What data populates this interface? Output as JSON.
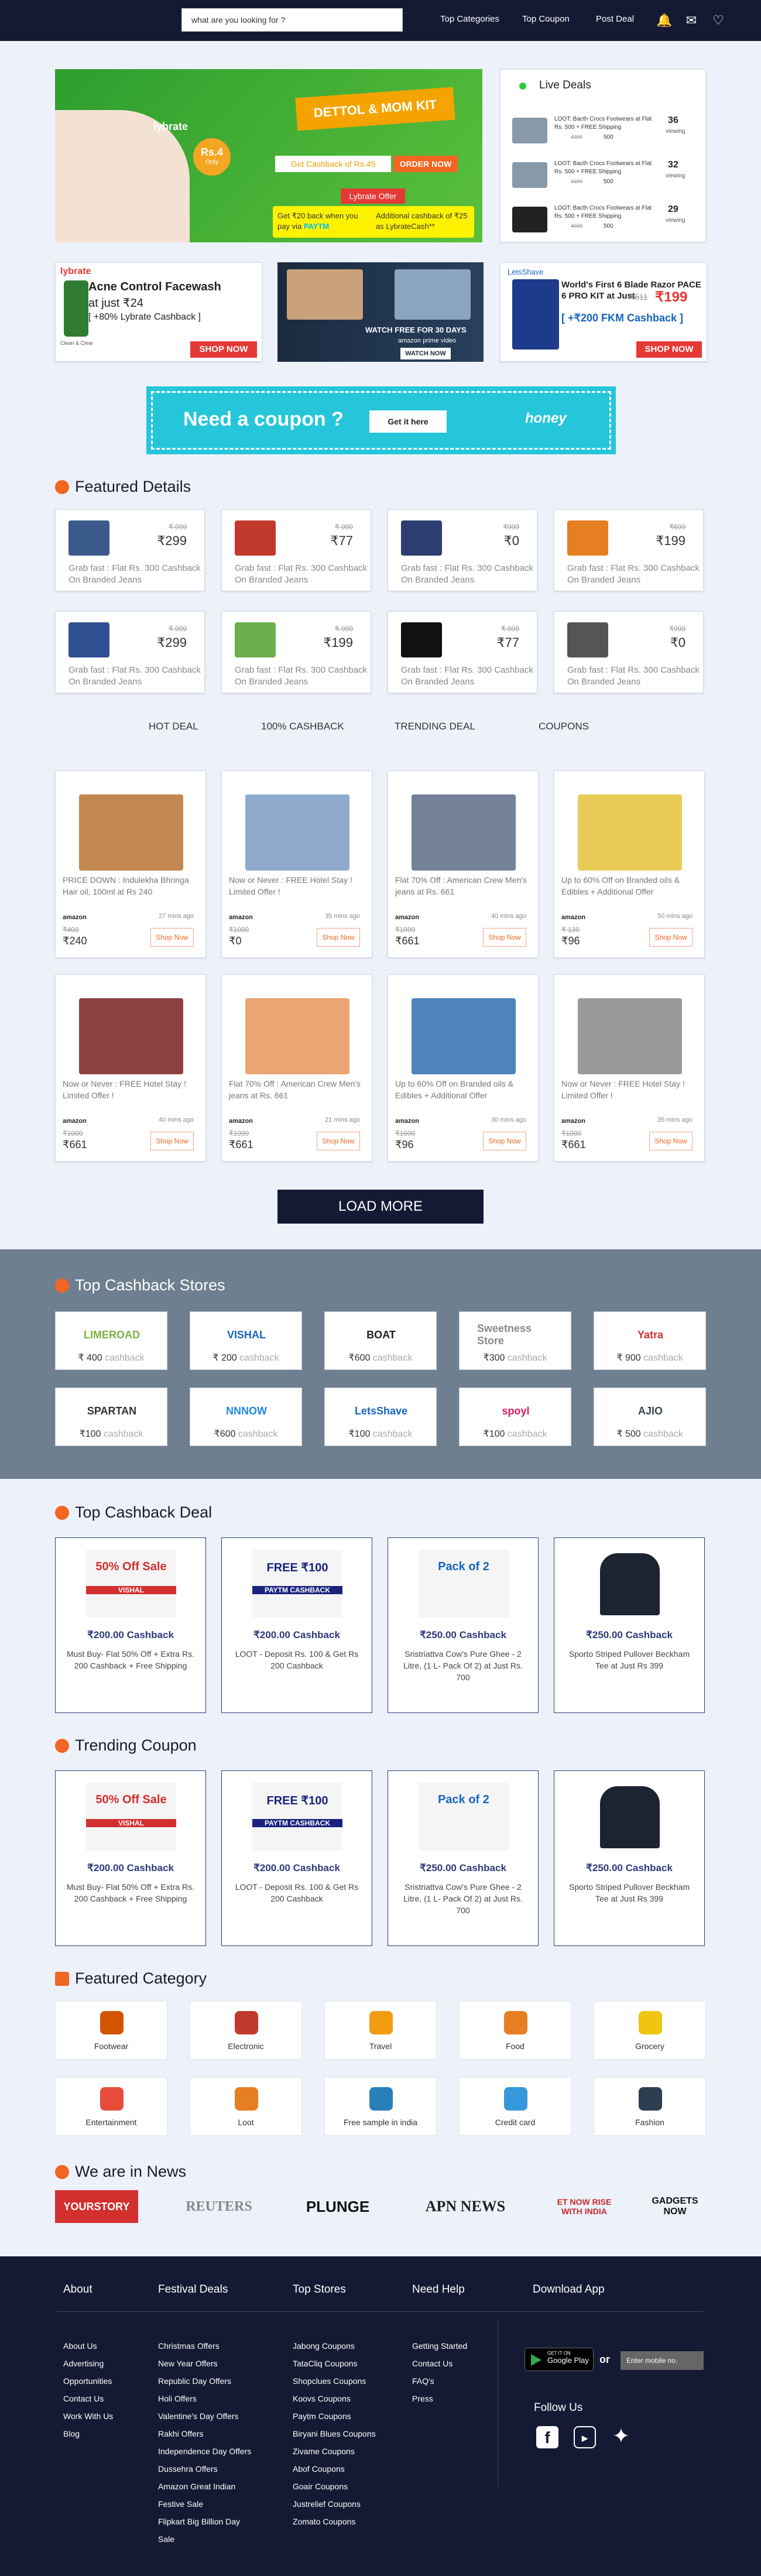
{
  "header": {
    "search_placeholder": "what are you looking for ?",
    "nav": [
      "Top Categories",
      "Top Coupon",
      "Post Deal"
    ]
  },
  "hero": {
    "brand": "lybrate",
    "kit_title": "DETTOL & MOM KIT",
    "price": "Rs.4",
    "price_sub": "Only",
    "cashback": "Get Cashback of Rs.45",
    "order_btn": "ORDER NOW",
    "offer_tag": "Lybrate Offer",
    "offer_left": "Get ₹20 back when you pay via",
    "offer_left_brand": "PAYTM",
    "offer_right": "Additional cashback of ₹25 as LybrateCash**"
  },
  "live_deals": {
    "title": "Live Deals",
    "items": [
      {
        "title": "LOOT: Bacth Crocs Footwears at Flat Rs. 500 + FREE Shipping",
        "old": "4999",
        "new": "500",
        "count": "36",
        "count_label": "viewing"
      },
      {
        "title": "LOOT: Bacth Crocs Footwears at Flat Rs. 500 + FREE Shipping",
        "old": "4999",
        "new": "500",
        "count": "32",
        "count_label": "viewing"
      },
      {
        "title": "LOOT: Bacth Crocs Footwears at Flat Rs. 500 + FREE Shipping",
        "old": "4999",
        "new": "500",
        "count": "29",
        "count_label": "viewing"
      }
    ]
  },
  "promo1": {
    "brand": "lybrate",
    "title": "Acne Control Facewash",
    "subtitle": "at just ₹24",
    "note": "[ +80% Lybrate Cashback ]",
    "btn": "SHOP NOW",
    "product": "Clean & Clear"
  },
  "promo2": {
    "title": "WATCH FREE FOR 30 DAYS",
    "brand": "amazon prime video",
    "btn": "WATCH NOW"
  },
  "promo3": {
    "brand": "LetsShave",
    "title": "World's First 6 Blade Razor PACE 6 PRO KIT at Just",
    "old": "₹611",
    "new": "₹199",
    "note": "[ +₹200 FKM Cashback ]",
    "btn": "SHOP NOW"
  },
  "coupon_banner": {
    "title": "Need a coupon ?",
    "btn": "Get it here",
    "brand": "honey"
  },
  "featured": {
    "title": "Featured Details",
    "items": [
      {
        "old": "₹ 999",
        "new": "₹299",
        "desc": "Grab fast : Flat Rs. 300 Cashback On Branded Jeans",
        "color": "#3a5a8c"
      },
      {
        "old": "₹ 999",
        "new": "₹77",
        "desc": "Grab fast : Flat Rs. 300 Cashback On Branded Jeans",
        "color": "#c0392b"
      },
      {
        "old": "₹999",
        "new": "₹0",
        "desc": "Grab fast : Flat Rs. 300 Cashback On Branded Jeans",
        "color": "#2c3e70"
      },
      {
        "old": "₹699",
        "new": "₹199",
        "desc": "Grab fast : Flat Rs. 300 Cashback On Branded Jeans",
        "color": "#e67e22"
      },
      {
        "old": "₹ 999",
        "new": "₹299",
        "desc": "Grab fast : Flat Rs. 300 Cashback On Branded Jeans",
        "color": "#2e5090"
      },
      {
        "old": "₹ 999",
        "new": "₹199",
        "desc": "Grab fast : Flat Rs. 300 Cashback On Branded Jeans",
        "color": "#6ab04c"
      },
      {
        "old": "₹ 999",
        "new": "₹77",
        "desc": "Grab fast : Flat Rs. 300 Cashback On Branded Jeans",
        "color": "#111111"
      },
      {
        "old": "₹999",
        "new": "₹0",
        "desc": "Grab fast : Flat Rs. 300 Cashback On Branded Jeans",
        "color": "#555555"
      }
    ]
  },
  "tabs": [
    "HOT DEAL",
    "100% CASHBACK",
    "TRENDING DEAL",
    "COUPONS"
  ],
  "deals": [
    {
      "title": "PRICE DOWN : Indulekha Bhringa Hair oil, 100ml at Rs 240",
      "brand": "amazon",
      "time": "27 mins ago",
      "old": "₹400",
      "new": "₹240",
      "btn": "Shop Now",
      "color": "#b87333"
    },
    {
      "title": "Now or Never : FREE Hotel Stay ! Limited Offer !",
      "brand": "amazon",
      "time": "35 mins ago",
      "old": "₹1000",
      "new": "₹0",
      "btn": "Shop Now",
      "color": "#7a9cc6"
    },
    {
      "title": "Flat 70% Off : American Crew Men's jeans at Rs. 661",
      "brand": "amazon",
      "time": "40 mins ago",
      "old": "₹1999",
      "new": "₹661",
      "btn": "Shop Now",
      "color": "#5a6c86"
    },
    {
      "title": "Up to 60% Off on Branded oils & Edibles + Additional Offer",
      "brand": "amazon",
      "time": "50 mins ago",
      "old": "₹ 130",
      "new": "₹96",
      "btn": "Shop Now",
      "color": "#e5c33a"
    },
    {
      "title": "Now or Never : FREE Hotel Stay ! Limited Offer !",
      "brand": "amazon",
      "time": "40 mins ago",
      "old": "₹1000",
      "new": "₹661",
      "btn": "Shop Now",
      "color": "#7a2020"
    },
    {
      "title": "Flat 70% Off : American Crew Men's jeans at Rs. 661",
      "brand": "amazon",
      "time": "21 mins ago",
      "old": "₹1999",
      "new": "₹661",
      "btn": "Shop Now",
      "color": "#e8945a"
    },
    {
      "title": "Up to 60% Off on Branded oils & Edibles + Additional Offer",
      "brand": "amazon",
      "time": "30 mins ago",
      "old": "₹1000",
      "new": "₹96",
      "btn": "Shop Now",
      "color": "#2f6fb0"
    },
    {
      "title": "Now or Never : FREE Hotel Stay ! Limited Offer !",
      "brand": "amazon",
      "time": "35 mins ago",
      "old": "₹1000",
      "new": "₹661",
      "btn": "Shop Now",
      "color": "#888888"
    }
  ],
  "load_more": "LOAD MORE",
  "stores": {
    "title": "Top Cashback Stores",
    "items": [
      {
        "name": "LIMEROAD",
        "amt": "₹ 400",
        "cb": "cashback",
        "color": "#7cb342"
      },
      {
        "name": "VISHAL",
        "amt": "₹ 200",
        "cb": "cashback",
        "color": "#1565c0"
      },
      {
        "name": "BOAT",
        "amt": "₹600",
        "cb": "cashback",
        "color": "#222222"
      },
      {
        "name": "Sweetness Store",
        "amt": "₹300",
        "cb": "cashback",
        "color": "#888888"
      },
      {
        "name": "Yatra",
        "amt": "₹ 900",
        "cb": "cashback",
        "color": "#d32f2f"
      },
      {
        "name": "SPARTAN",
        "amt": "₹100",
        "cb": "cashback",
        "color": "#333333"
      },
      {
        "name": "NNNOW",
        "amt": "₹600",
        "cb": "cashback",
        "color": "#1e88e5"
      },
      {
        "name": "LetsShave",
        "amt": "₹100",
        "cb": "cashback",
        "color": "#1565c0"
      },
      {
        "name": "spoyl",
        "amt": "₹100",
        "cb": "cashback",
        "color": "#d81b60"
      },
      {
        "name": "AJIO",
        "amt": "₹ 500",
        "cb": "cashback",
        "color": "#37474f"
      }
    ]
  },
  "cashback_deals": {
    "title": "Top Cashback Deal",
    "items": [
      {
        "amt": "₹200.00 Cashback",
        "desc": "Must Buy- Flat 50% Off + Extra Rs. 200 Cashback + Free Shipping",
        "label": "50% Off Sale",
        "brand": "VISHAL",
        "color": "#d32f2f"
      },
      {
        "amt": "₹200.00 Cashback",
        "desc": "LOOT - Deposit Rs. 100 & Get Rs 200 Cashback",
        "label": "FREE ₹100",
        "brand": "PAYTM CASHBACK",
        "color": "#1a237e"
      },
      {
        "amt": "₹250.00 Cashback",
        "desc": "Sristriattva Cow's Pure Ghee - 2 Litre, (1 L- Pack Of 2) at Just Rs. 700",
        "label": "Pack of 2",
        "brand": "",
        "color": "#1565c0"
      },
      {
        "amt": "₹250.00 Cashback",
        "desc": "Sporto Striped Pullover Beckham Tee at Just Rs 399",
        "label": "",
        "brand": "",
        "color": "#1c2331"
      }
    ]
  },
  "trending": {
    "title": "Trending Coupon",
    "items": [
      {
        "amt": "₹200.00 Cashback",
        "desc": "Must Buy- Flat 50% Off + Extra Rs. 200 Cashback + Free Shipping",
        "label": "50% Off Sale",
        "brand": "VISHAL",
        "color": "#d32f2f"
      },
      {
        "amt": "₹200.00 Cashback",
        "desc": "LOOT - Deposit Rs. 100 & Get Rs 200 Cashback",
        "label": "FREE ₹100",
        "brand": "PAYTM CASHBACK",
        "color": "#1a237e"
      },
      {
        "amt": "₹250.00 Cashback",
        "desc": "Sristriattva Cow's Pure Ghee - 2 Litre, (1 L- Pack Of 2) at Just Rs. 700",
        "label": "Pack of 2",
        "brand": "",
        "color": "#1565c0"
      },
      {
        "amt": "₹250.00 Cashback",
        "desc": "Sporto Striped Pullover Beckham Tee at Just Rs 399",
        "label": "",
        "brand": "",
        "color": "#1c2331"
      }
    ]
  },
  "categories": {
    "title": "Featured Category",
    "items": [
      {
        "label": "Footwear",
        "color": "#d35400"
      },
      {
        "label": "Electronic",
        "color": "#c0392b"
      },
      {
        "label": "Travel",
        "color": "#f39c12"
      },
      {
        "label": "Food",
        "color": "#e67e22"
      },
      {
        "label": "Grocery",
        "color": "#f1c40f"
      },
      {
        "label": "Entertainment",
        "color": "#e74c3c"
      },
      {
        "label": "Loot",
        "color": "#e67e22"
      },
      {
        "label": "Free sample in india",
        "color": "#2980b9"
      },
      {
        "label": "Credit card",
        "color": "#3498db"
      },
      {
        "label": "Fashion",
        "color": "#2c3e50"
      }
    ]
  },
  "news": {
    "title": "We are in News",
    "logos": [
      "YOURSTORY",
      "REUTERS",
      "PLUNGE",
      "APN NEWS",
      "ET NOW RISE WITH INDIA",
      "GADGETS NOW"
    ]
  },
  "footer": {
    "cols": [
      {
        "head": "About",
        "links": [
          "About Us",
          "Advertising",
          "Opportunities",
          "Contact Us",
          "Work With Us",
          "Blog"
        ]
      },
      {
        "head": "Festival Deals",
        "links": [
          "Christmas Offers",
          "New Year Offers",
          "Republic Day Offers",
          "Holi Offers",
          "Valentine's Day Offers",
          "Rakhi Offers",
          "Independence Day Offers",
          "Dussehra Offers",
          "Amazon Great Indian Festive Sale",
          "Flipkart Big Billion Day Sale"
        ]
      },
      {
        "head": "Top Stores",
        "links": [
          "Jabong Coupons",
          "TataCliq Coupons",
          "Shopclues Coupons",
          "Koovs Coupons",
          "Paytm Coupons",
          "Biryani Blues Coupons",
          "Zivame Coupons",
          "Abof Coupons",
          "Goair Coupons",
          "Justrelief Coupons",
          "Zomato Coupons"
        ]
      },
      {
        "head": "Need Help",
        "links": [
          "Getting Started",
          "Contact Us",
          "FAQ's",
          "Press"
        ]
      }
    ],
    "download": "Download App",
    "gplay_small": "GET IT ON",
    "gplay": "Google Play",
    "or": "or",
    "mobile_placeholder": "Enter mobile no.",
    "follow": "Follow Us"
  }
}
